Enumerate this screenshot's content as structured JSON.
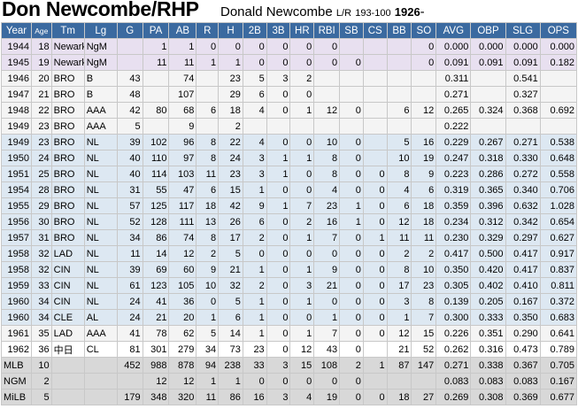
{
  "header": {
    "title": "Don Newcombe/RHP",
    "full_name": "Donald Newcombe",
    "bats_throws": "L/R",
    "height_weight": "193-100",
    "birth_year": "1926",
    "birth_suffix": "-"
  },
  "columns": [
    "Year",
    "Age",
    "Tm",
    "Lg",
    "G",
    "PA",
    "AB",
    "R",
    "H",
    "2B",
    "3B",
    "HR",
    "RBI",
    "SB",
    "CS",
    "BB",
    "SO",
    "AVG",
    "OBP",
    "SLG",
    "OPS"
  ],
  "rows": [
    {
      "type": "ngm",
      "cells": [
        "1944",
        "18",
        "Newark",
        "NgM",
        "",
        "1",
        "1",
        "0",
        "0",
        "0",
        "0",
        "0",
        "0",
        "",
        "",
        "",
        "0",
        "0.000",
        "0.000",
        "0.000",
        "0.000"
      ]
    },
    {
      "type": "ngm",
      "cells": [
        "1945",
        "19",
        "Newark",
        "NgM",
        "",
        "11",
        "11",
        "1",
        "1",
        "0",
        "0",
        "0",
        "0",
        "0",
        "",
        "",
        "0",
        "0.091",
        "0.091",
        "0.091",
        "0.182"
      ]
    },
    {
      "type": "milb",
      "cells": [
        "1946",
        "20",
        "BRO",
        "B",
        "43",
        "",
        "74",
        "",
        "23",
        "5",
        "3",
        "2",
        "",
        "",
        "",
        "",
        "",
        "0.311",
        "",
        "0.541",
        ""
      ]
    },
    {
      "type": "milb",
      "cells": [
        "1947",
        "21",
        "BRO",
        "B",
        "48",
        "",
        "107",
        "",
        "29",
        "6",
        "0",
        "0",
        "",
        "",
        "",
        "",
        "",
        "0.271",
        "",
        "0.327",
        ""
      ]
    },
    {
      "type": "milb",
      "cells": [
        "1948",
        "22",
        "BRO",
        "AAA",
        "42",
        "80",
        "68",
        "6",
        "18",
        "4",
        "0",
        "1",
        "12",
        "0",
        "",
        "6",
        "12",
        "0.265",
        "0.324",
        "0.368",
        "0.692"
      ]
    },
    {
      "type": "milb",
      "cells": [
        "1949",
        "23",
        "BRO",
        "AAA",
        "5",
        "",
        "9",
        "",
        "2",
        "",
        "",
        "",
        "",
        "",
        "",
        "",
        "",
        "0.222",
        "",
        "",
        ""
      ]
    },
    {
      "type": "mlb",
      "cells": [
        "1949",
        "23",
        "BRO",
        "NL",
        "39",
        "102",
        "96",
        "8",
        "22",
        "4",
        "0",
        "0",
        "10",
        "0",
        "",
        "5",
        "16",
        "0.229",
        "0.267",
        "0.271",
        "0.538"
      ]
    },
    {
      "type": "mlb",
      "cells": [
        "1950",
        "24",
        "BRO",
        "NL",
        "40",
        "110",
        "97",
        "8",
        "24",
        "3",
        "1",
        "1",
        "8",
        "0",
        "",
        "10",
        "19",
        "0.247",
        "0.318",
        "0.330",
        "0.648"
      ]
    },
    {
      "type": "mlb",
      "cells": [
        "1951",
        "25",
        "BRO",
        "NL",
        "40",
        "114",
        "103",
        "11",
        "23",
        "3",
        "1",
        "0",
        "8",
        "0",
        "0",
        "8",
        "9",
        "0.223",
        "0.286",
        "0.272",
        "0.558"
      ]
    },
    {
      "type": "mlb",
      "cells": [
        "1954",
        "28",
        "BRO",
        "NL",
        "31",
        "55",
        "47",
        "6",
        "15",
        "1",
        "0",
        "0",
        "4",
        "0",
        "0",
        "4",
        "6",
        "0.319",
        "0.365",
        "0.340",
        "0.706"
      ]
    },
    {
      "type": "mlb",
      "cells": [
        "1955",
        "29",
        "BRO",
        "NL",
        "57",
        "125",
        "117",
        "18",
        "42",
        "9",
        "1",
        "7",
        "23",
        "1",
        "0",
        "6",
        "18",
        "0.359",
        "0.396",
        "0.632",
        "1.028"
      ]
    },
    {
      "type": "mlb",
      "cells": [
        "1956",
        "30",
        "BRO",
        "NL",
        "52",
        "128",
        "111",
        "13",
        "26",
        "6",
        "0",
        "2",
        "16",
        "1",
        "0",
        "12",
        "18",
        "0.234",
        "0.312",
        "0.342",
        "0.654"
      ]
    },
    {
      "type": "mlb",
      "cells": [
        "1957",
        "31",
        "BRO",
        "NL",
        "34",
        "86",
        "74",
        "8",
        "17",
        "2",
        "0",
        "1",
        "7",
        "0",
        "1",
        "11",
        "11",
        "0.230",
        "0.329",
        "0.297",
        "0.627"
      ]
    },
    {
      "type": "mlb",
      "cells": [
        "1958",
        "32",
        "LAD",
        "NL",
        "11",
        "14",
        "12",
        "2",
        "5",
        "0",
        "0",
        "0",
        "0",
        "0",
        "0",
        "2",
        "2",
        "0.417",
        "0.500",
        "0.417",
        "0.917"
      ]
    },
    {
      "type": "mlb",
      "cells": [
        "1958",
        "32",
        "CIN",
        "NL",
        "39",
        "69",
        "60",
        "9",
        "21",
        "1",
        "0",
        "1",
        "9",
        "0",
        "0",
        "8",
        "10",
        "0.350",
        "0.420",
        "0.417",
        "0.837"
      ]
    },
    {
      "type": "mlb",
      "cells": [
        "1959",
        "33",
        "CIN",
        "NL",
        "61",
        "123",
        "105",
        "10",
        "32",
        "2",
        "0",
        "3",
        "21",
        "0",
        "0",
        "17",
        "23",
        "0.305",
        "0.402",
        "0.410",
        "0.811"
      ]
    },
    {
      "type": "mlb",
      "cells": [
        "1960",
        "34",
        "CIN",
        "NL",
        "24",
        "41",
        "36",
        "0",
        "5",
        "1",
        "0",
        "1",
        "0",
        "0",
        "0",
        "3",
        "8",
        "0.139",
        "0.205",
        "0.167",
        "0.372"
      ]
    },
    {
      "type": "mlb",
      "cells": [
        "1960",
        "34",
        "CLE",
        "AL",
        "24",
        "21",
        "20",
        "1",
        "6",
        "1",
        "0",
        "0",
        "1",
        "0",
        "0",
        "1",
        "7",
        "0.300",
        "0.333",
        "0.350",
        "0.683"
      ]
    },
    {
      "type": "milb",
      "cells": [
        "1961",
        "35",
        "LAD",
        "AAA",
        "41",
        "78",
        "62",
        "5",
        "14",
        "1",
        "0",
        "1",
        "7",
        "0",
        "0",
        "12",
        "15",
        "0.226",
        "0.351",
        "0.290",
        "0.641"
      ]
    },
    {
      "type": "foreign",
      "cells": [
        "1962",
        "36",
        "中日",
        "CL",
        "81",
        "301",
        "279",
        "34",
        "73",
        "23",
        "0",
        "12",
        "43",
        "0",
        "",
        "21",
        "52",
        "0.262",
        "0.316",
        "0.473",
        "0.789"
      ]
    },
    {
      "type": "total",
      "cells": [
        "MLB",
        "10",
        "",
        "",
        "452",
        "988",
        "878",
        "94",
        "238",
        "33",
        "3",
        "15",
        "108",
        "2",
        "1",
        "87",
        "147",
        "0.271",
        "0.338",
        "0.367",
        "0.705"
      ]
    },
    {
      "type": "total",
      "cells": [
        "NGM",
        "2",
        "",
        "",
        "",
        "12",
        "12",
        "1",
        "1",
        "0",
        "0",
        "0",
        "0",
        "0",
        "",
        "",
        "",
        "0.083",
        "0.083",
        "0.083",
        "0.167"
      ]
    },
    {
      "type": "total",
      "cells": [
        "MiLB",
        "5",
        "",
        "",
        "179",
        "348",
        "320",
        "11",
        "86",
        "16",
        "3",
        "4",
        "19",
        "0",
        "0",
        "18",
        "27",
        "0.269",
        "0.308",
        "0.369",
        "0.677"
      ]
    }
  ]
}
